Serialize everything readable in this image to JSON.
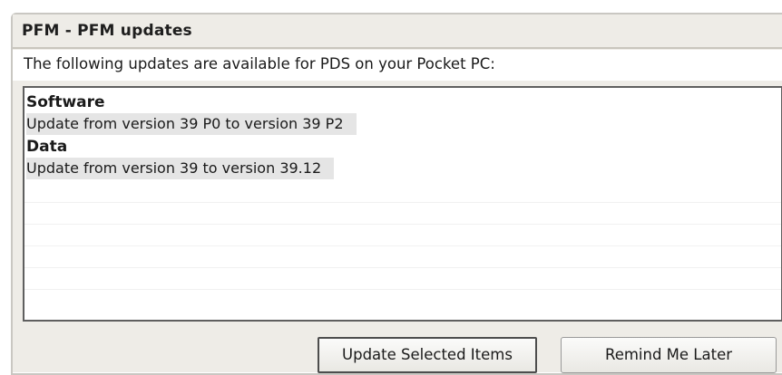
{
  "window": {
    "title": "PFM - PFM updates"
  },
  "instruction": "The following updates are available for PDS on your Pocket PC:",
  "updates": {
    "categories": [
      {
        "name": "Software",
        "items": [
          "Update from version 39 P0 to version 39 P2"
        ]
      },
      {
        "name": "Data",
        "items": [
          "Update from version 39 to version 39.12"
        ]
      }
    ]
  },
  "buttons": {
    "update_selected": "Update Selected Items",
    "remind_later": "Remind Me Later"
  },
  "colors": {
    "window_background": "#eeece7",
    "item_highlight": "#e5e5e5",
    "list_border": "#5f5f5f"
  }
}
